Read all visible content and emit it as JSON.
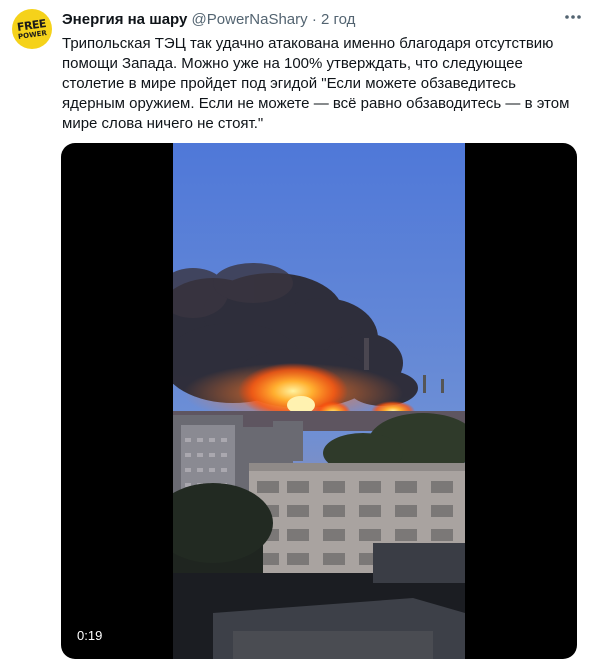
{
  "tweet": {
    "author_name": "Энергия на шару",
    "handle": "@PowerNaShary",
    "separator": "·",
    "timestamp": "2 год",
    "more_icon": "ellipsis-icon",
    "text_lines": [
      "Трипольская ТЭЦ так удачно атакована именно благодаря отсутствию",
      "помощи Запада. Можно уже на 100% утверждать, что следующее",
      "столетие в мире пройдет под эгидой \"Если можете обзаведитесь",
      "ядерным оружием. Если не можете — всё равно обзаводитесь — в этом",
      "мире слова ничего не стоят.\""
    ]
  },
  "avatar": {
    "line1": "FREE",
    "line2": "POWER",
    "color": "#f5d21a"
  },
  "media": {
    "type": "video",
    "duration": "0:19",
    "accent_fire": "#ff7a1a",
    "sky": "#5a7fd0"
  }
}
